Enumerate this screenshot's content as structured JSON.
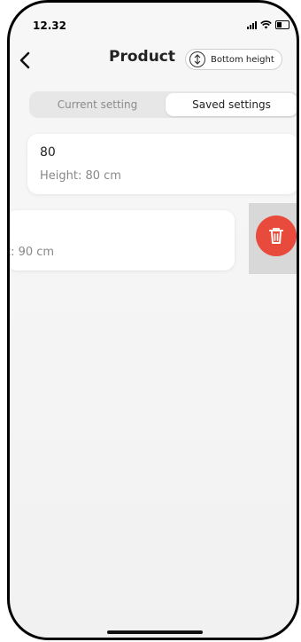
{
  "status_bar": {
    "time": "12.32",
    "icons": [
      "signal-icon",
      "wifi-icon",
      "battery-icon"
    ]
  },
  "nav": {
    "back_icon": "chevron-left-icon",
    "title": "Product",
    "bottom_height_label": "Bottom height",
    "bottom_height_icon": "vertical-arrows-icon"
  },
  "tabs": {
    "current": "Current setting",
    "saved": "Saved settings",
    "active": "saved"
  },
  "saved_items": [
    {
      "title": "80",
      "subtitle": "Height: 80 cm"
    },
    {
      "title": "",
      "subtitle_visible": "t: 90 cm"
    }
  ],
  "delete_action": {
    "icon": "trash-icon",
    "color": "#e84a3c"
  },
  "colors": {
    "accent_delete": "#e84a3c",
    "card": "#ffffff",
    "segment_bg": "#e7e7e7"
  }
}
